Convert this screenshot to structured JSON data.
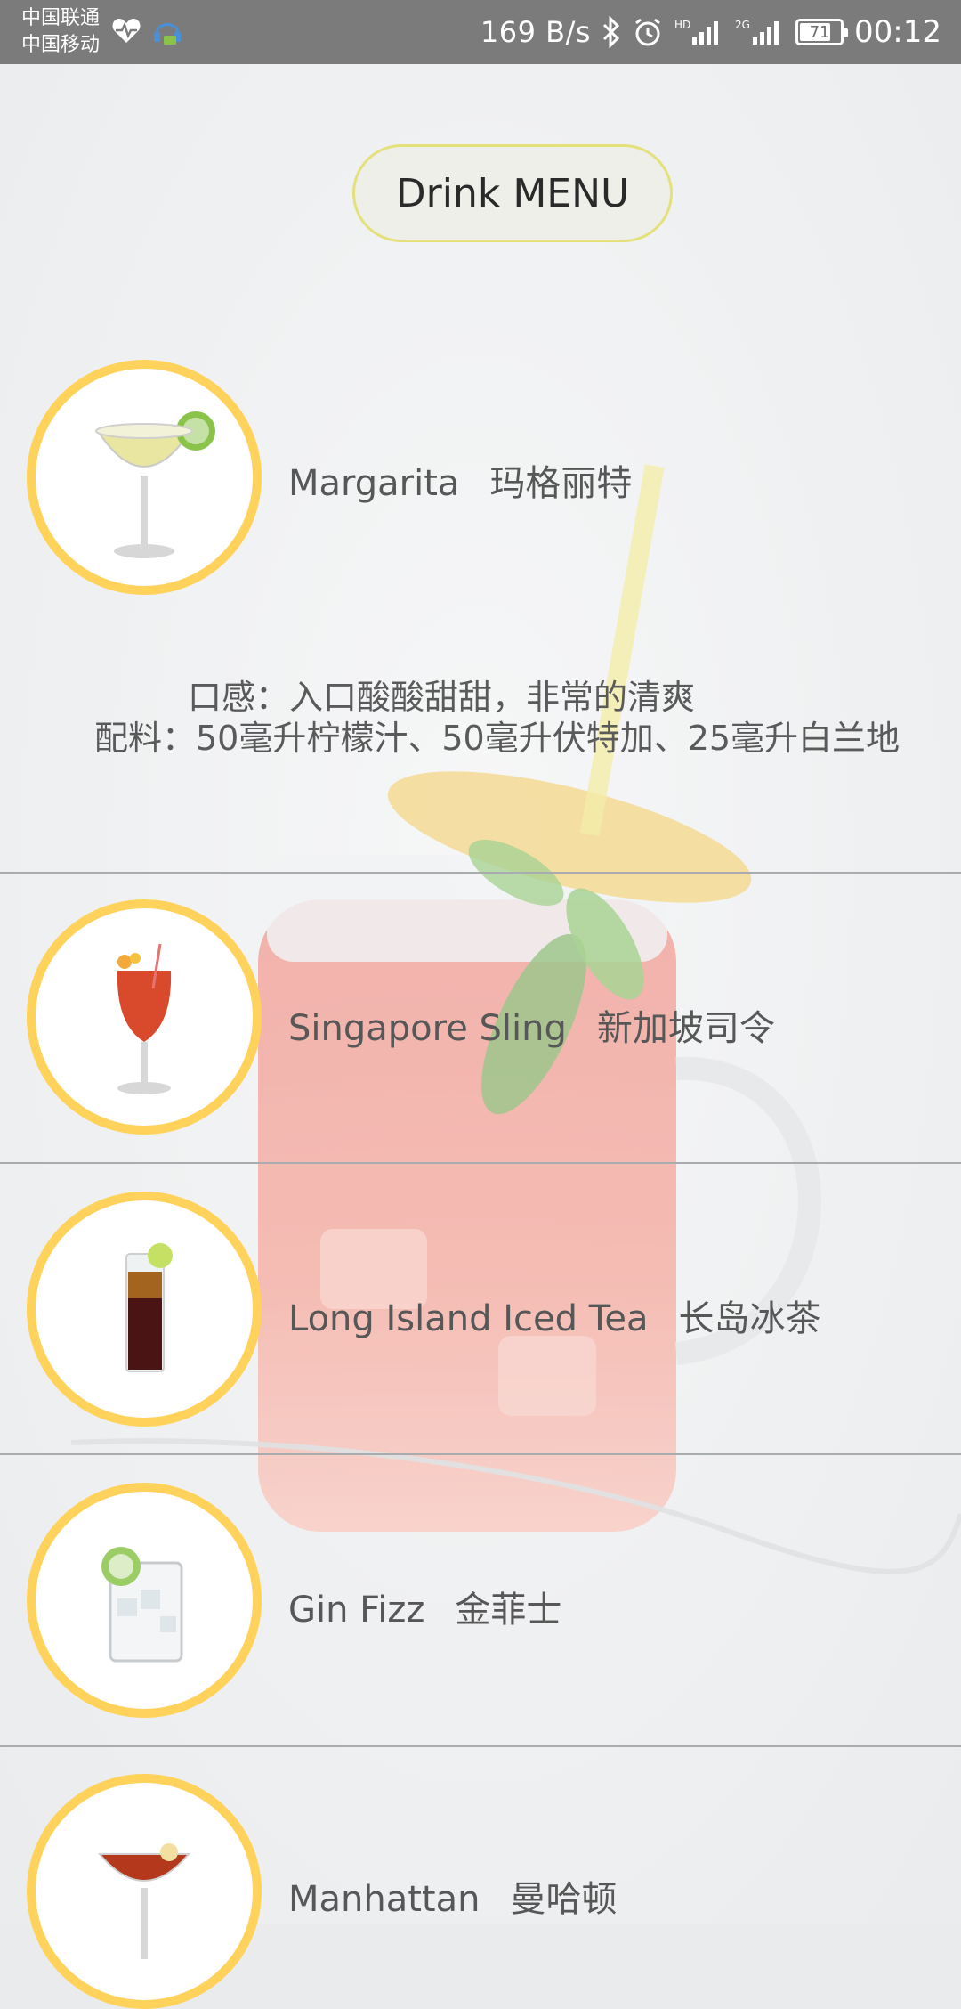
{
  "status_bar": {
    "carrier_1": "中国联通",
    "carrier_2": "中国移动",
    "net_speed": "169 B/s",
    "battery_level": "71",
    "time": "00:12"
  },
  "header": {
    "title": "Drink MENU"
  },
  "drinks": [
    {
      "name_en": "Margarita",
      "name_cn": "玛格丽特",
      "taste": "口感：入口酸酸甜甜，非常的清爽",
      "ingredients": "配料：50毫升柠檬汁、50毫升伏特加、25毫升白兰地"
    },
    {
      "name_en": "Singapore Sling",
      "name_cn": "新加坡司令"
    },
    {
      "name_en": "Long Island Iced Tea",
      "name_cn": "长岛冰茶"
    },
    {
      "name_en": "Gin Fizz",
      "name_cn": "金菲士"
    },
    {
      "name_en": "Manhattan",
      "name_cn": "曼哈顿"
    }
  ],
  "colors": {
    "status_bar": "#7b7b7b",
    "thumb_ring": "#ffd25c",
    "pill_border": "#e4e07a",
    "divider": "#a9acae",
    "text": "#575757"
  }
}
